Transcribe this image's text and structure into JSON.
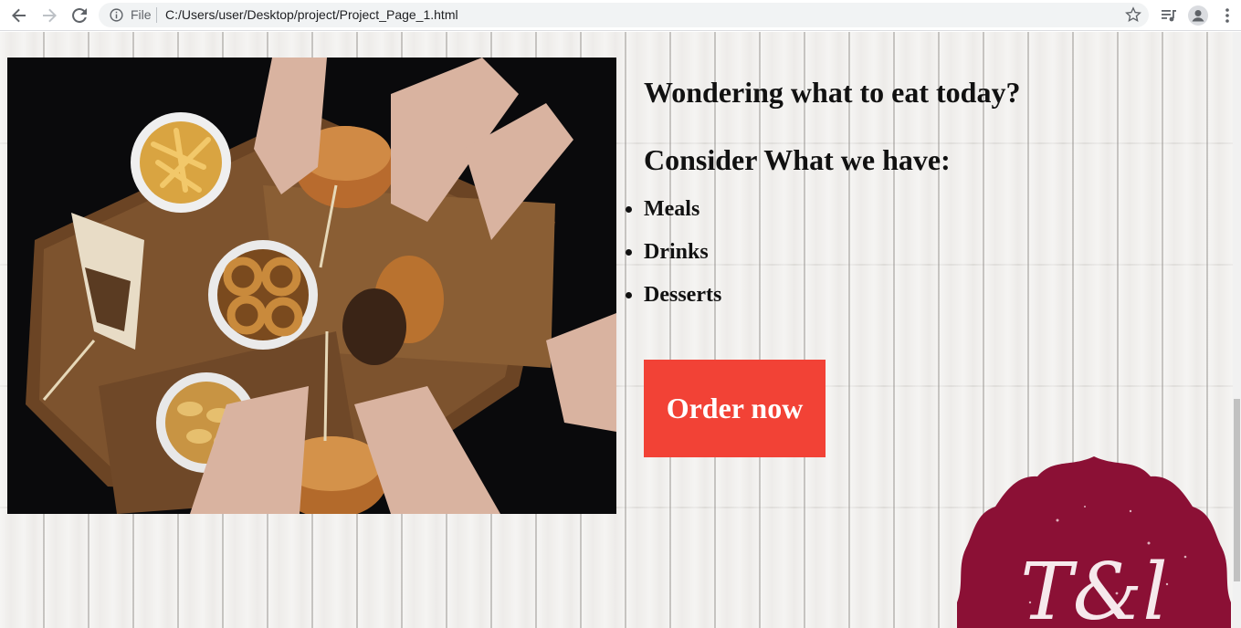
{
  "browser": {
    "file_label": "File",
    "url": "C:/Users/user/Desktop/project/Project_Page_1.html"
  },
  "page": {
    "heading_1": "Wondering what to eat today?",
    "heading_2": "Consider What we have:",
    "menu_items": [
      "Meals",
      "Drinks",
      "Desserts"
    ],
    "order_button": "Order now",
    "logo_text": "T&l"
  },
  "colors": {
    "order_button_bg": "#f24236",
    "badge_bg": "#8b1035"
  },
  "icons": [
    "back-icon",
    "forward-icon",
    "reload-icon",
    "info-icon",
    "star-icon",
    "reading-list-icon",
    "profile-icon",
    "kebab-menu-icon"
  ]
}
